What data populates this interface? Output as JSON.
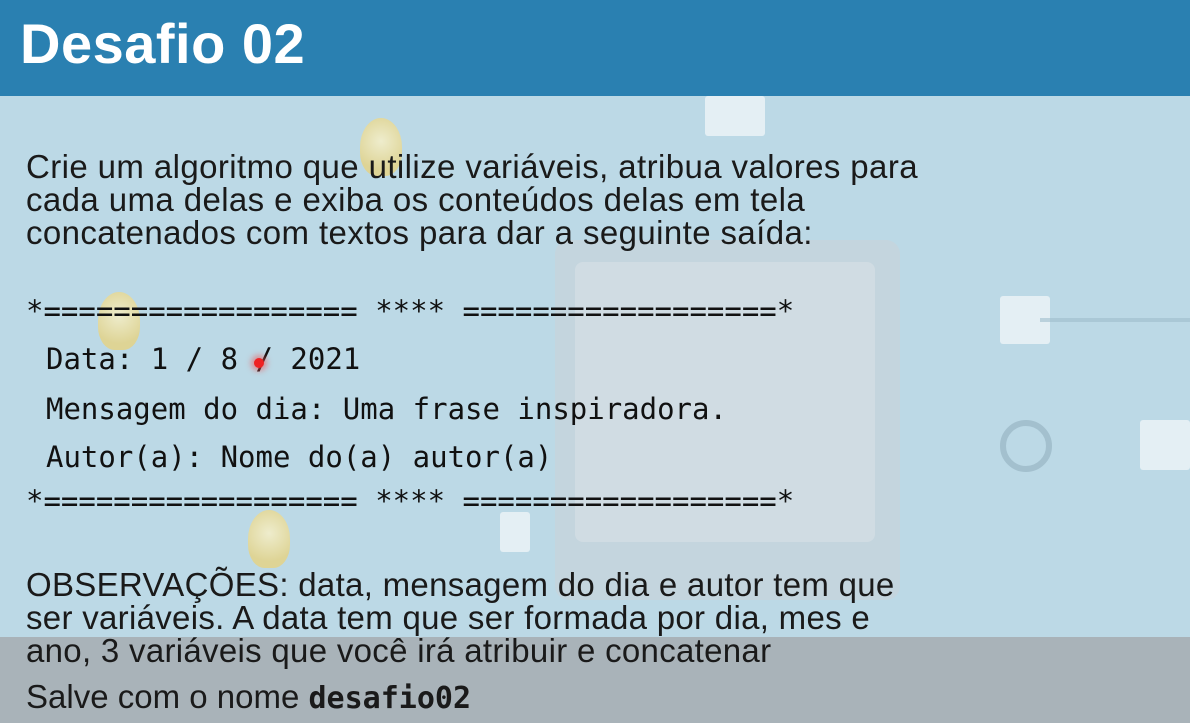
{
  "header": {
    "title": "Desafio 02"
  },
  "intro": {
    "lines": [
      "Crie um algoritmo que utilize variáveis, atribua valores para",
      "cada uma delas e exiba os conteúdos delas em tela",
      "concatenados com textos para dar a seguinte saída:"
    ]
  },
  "output": {
    "border_top": "*================== **** ==================*",
    "date_line": "Data: 1 / 8 / 2021",
    "message_line": "Mensagem do dia: Uma frase inspiradora.",
    "author_line": "Autor(a): Nome do(a) autor(a)",
    "border_bottom": "*================== **** ==================*"
  },
  "notes": {
    "lines": [
      "OBSERVAÇÕES: data, mensagem do dia e autor tem que",
      "ser variáveis. A data tem que ser formada por dia, mes e",
      "ano, 3 variáveis que você irá atribuir e concatenar"
    ]
  },
  "save": {
    "prefix": "Salve com o nome ",
    "filename": "desafio02"
  },
  "colors": {
    "header_bg": "#2a80b1",
    "page_bg": "#bcd9e6",
    "footer_bg": "#a9b3b9",
    "pointer": "#e22222"
  },
  "icons": [
    "lightbulb-icon",
    "monitor-icon",
    "mouse-pointer-icon"
  ]
}
